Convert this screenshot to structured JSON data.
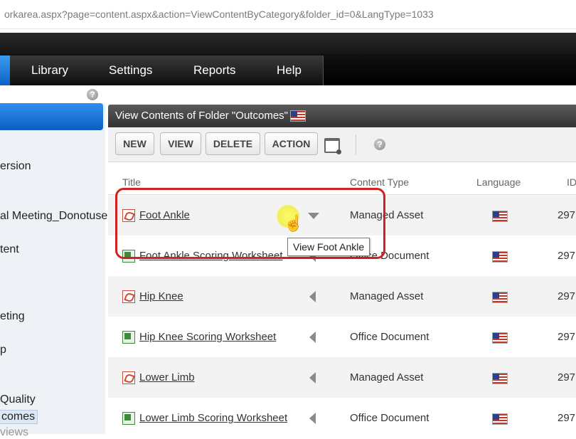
{
  "address_bar": {
    "url": "orkarea.aspx?page=content.aspx&action=ViewContentByCategory&folder_id=0&LangType=1033"
  },
  "top_menu": {
    "items": [
      {
        "label": "Library"
      },
      {
        "label": "Settings"
      },
      {
        "label": "Reports"
      },
      {
        "label": "Help"
      }
    ]
  },
  "help_icon_glyph": "?",
  "sidebar": {
    "items": [
      {
        "label": "ersion"
      },
      {
        "label": "al Meeting_Donotuse"
      },
      {
        "label": "tent"
      },
      {
        "label": "eting"
      },
      {
        "label": "p"
      },
      {
        "label": "Quality"
      },
      {
        "label": "comes"
      },
      {
        "label": "views"
      }
    ]
  },
  "panel": {
    "title": "View Contents of Folder \"Outcomes\""
  },
  "toolbar": {
    "new_label": "NEW",
    "view_label": "VIEW",
    "delete_label": "DELETE",
    "action_label": "ACTION"
  },
  "table": {
    "headers": {
      "title": "Title",
      "content_type": "Content Type",
      "language": "Language",
      "id": "ID"
    },
    "rows": [
      {
        "title": "Foot Ankle",
        "icon": "pdf-icon",
        "content_type": "Managed Asset",
        "id": "297"
      },
      {
        "title": "Foot Ankle Scoring Worksheet",
        "icon": "spreadsheet-icon",
        "content_type": "Office Document",
        "id": "297"
      },
      {
        "title": "Hip Knee",
        "icon": "pdf-icon",
        "content_type": "Managed Asset",
        "id": "297"
      },
      {
        "title": "Hip Knee Scoring Worksheet",
        "icon": "spreadsheet-icon",
        "content_type": "Office Document",
        "id": "297"
      },
      {
        "title": "Lower Limb",
        "icon": "pdf-icon",
        "content_type": "Managed Asset",
        "id": "297"
      },
      {
        "title": "Lower Limb Scoring Worksheet",
        "icon": "spreadsheet-icon",
        "content_type": "Office Document",
        "id": "297"
      }
    ]
  },
  "tooltip": {
    "text": "View Foot Ankle"
  },
  "colors": {
    "highlight": "#d32020",
    "accent_blue": "#0a5fbf",
    "cursor_glow": "#f3ef55"
  }
}
